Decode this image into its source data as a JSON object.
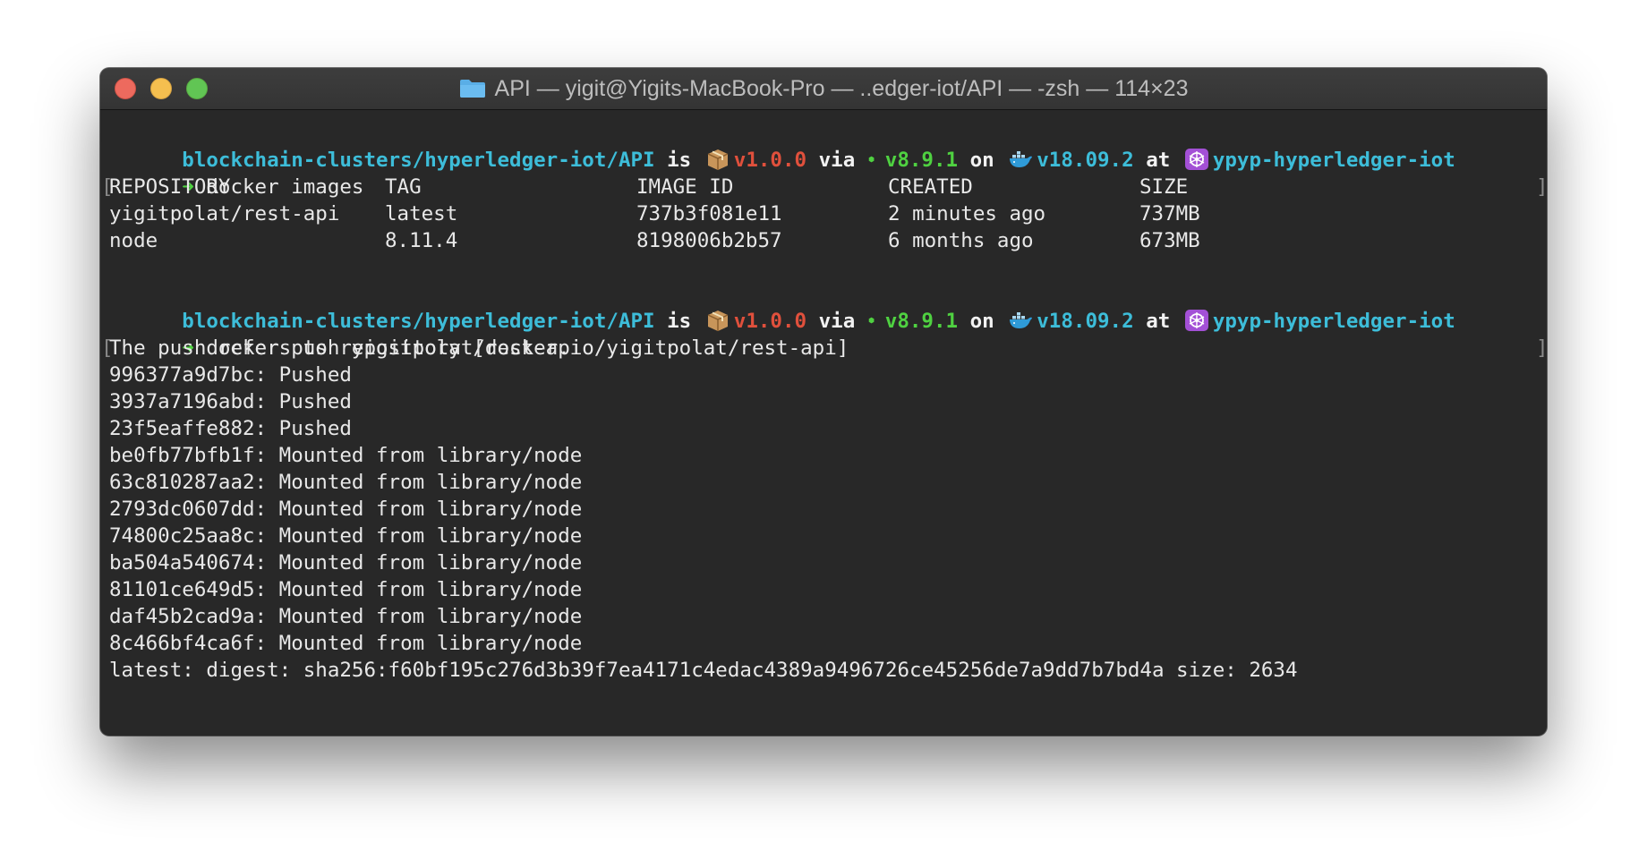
{
  "window": {
    "title": "API — yigit@Yigits-MacBook-Pro — ..edger-iot/API — -zsh — 114×23"
  },
  "prompt": {
    "path": "blockchain-clusters/hyperledger-iot/API",
    "is": "is",
    "package_version": "v1.0.0",
    "via": "via",
    "node_version": "v8.9.1",
    "on": "on",
    "docker_version": "v18.09.2",
    "at": "at",
    "k8s_context": "ypyp-hyperledger-iot",
    "arrow": "➜",
    "colors": {
      "path": "#3dbdd9",
      "package": "#e0503c",
      "node": "#4fd141",
      "docker": "#3dbdd9",
      "context": "#3dbdd9"
    }
  },
  "commands": {
    "first": "docker images",
    "second": "docker push yigitpolat/rest-api"
  },
  "images_table": {
    "headers": [
      "REPOSITORY",
      "TAG",
      "IMAGE ID",
      "CREATED",
      "SIZE"
    ],
    "rows": [
      [
        "yigitpolat/rest-api",
        "latest",
        "737b3f081e11",
        "2 minutes ago",
        "737MB"
      ],
      [
        "node",
        "8.11.4",
        "8198006b2b57",
        "6 months ago",
        "673MB"
      ]
    ]
  },
  "push_output": [
    "The push refers to repository [docker.io/yigitpolat/rest-api]",
    "996377a9d7bc: Pushed",
    "3937a7196abd: Pushed",
    "23f5eaffe882: Pushed",
    "be0fb77bfb1f: Mounted from library/node",
    "63c810287aa2: Mounted from library/node",
    "2793dc0607dd: Mounted from library/node",
    "74800c25aa8c: Mounted from library/node",
    "ba504a540674: Mounted from library/node",
    "81101ce649d5: Mounted from library/node",
    "daf45b2cad9a: Mounted from library/node",
    "8c466bf4ca6f: Mounted from library/node",
    "latest: digest: sha256:f60bf195c276d3b39f7ea4171c4edac4389a9496726ce45256de7a9dd7b7bd4a size: 2634"
  ],
  "icons": [
    "package-icon",
    "node-icon",
    "docker-whale-icon",
    "kubernetes-icon",
    "folder-icon"
  ]
}
